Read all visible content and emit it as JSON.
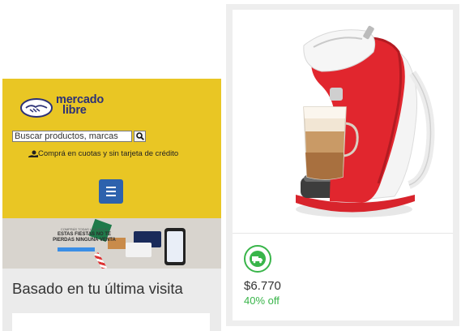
{
  "mobile": {
    "logo": {
      "line1": "mercado",
      "line2": "libre"
    },
    "search": {
      "value": "Buscar productos, marcas"
    },
    "promo_text": "Comprá en cuotas y sin tarjeta de crédito",
    "banner": {
      "small_text": "COMPRÁS TODAS LAS VECES",
      "headline": "ESTAS FIESTAS NO TE PIERDAS NINGUNA VENTA"
    },
    "section_title": "Basado en tu última visita"
  },
  "product": {
    "price": "$6.770",
    "discount": "40% off",
    "shipping_icon": "truck-icon"
  },
  "colors": {
    "brand_yellow": "#e9c624",
    "brand_blue": "#2d3277",
    "menu_blue": "#2d62ad",
    "success_green": "#39b54a"
  }
}
